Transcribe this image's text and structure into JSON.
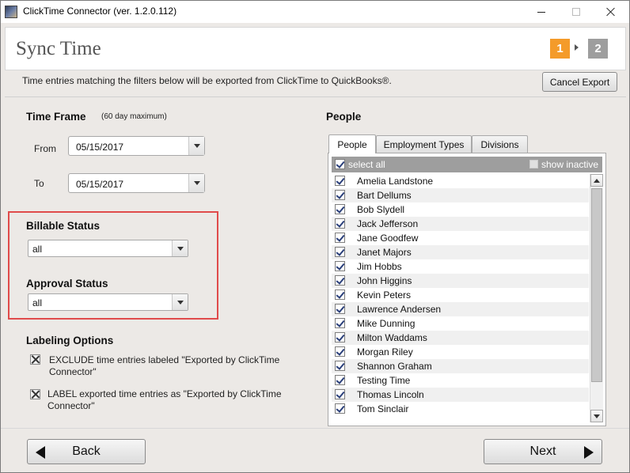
{
  "window": {
    "title": "ClickTime Connector (ver. 1.2.0.112)"
  },
  "header": {
    "page_title": "Sync Time",
    "steps": [
      "1",
      "2"
    ],
    "active_step": "1",
    "accent_color": "#f49b2a"
  },
  "description": "Time entries matching the filters below will be exported from ClickTime to QuickBooks®.",
  "cancel_label": "Cancel Export",
  "time_frame": {
    "title": "Time Frame",
    "note": "(60 day maximum)",
    "from_label": "From",
    "from_value": "05/15/2017",
    "to_label": "To",
    "to_value": "05/15/2017"
  },
  "billable": {
    "title": "Billable Status",
    "value": "all"
  },
  "approval": {
    "title": "Approval Status",
    "value": "all"
  },
  "labeling": {
    "title": "Labeling Options",
    "option1": "EXCLUDE time entries labeled \"Exported by ClickTime Connector\"",
    "option2": "LABEL exported time entries as \"Exported by ClickTime Connector\"",
    "option1_checked": true,
    "option2_checked": true
  },
  "people": {
    "title": "People",
    "tabs": [
      "People",
      "Employment Types",
      "Divisions"
    ],
    "active_tab": "People",
    "select_all_label": "select all",
    "show_inactive_label": "show inactive",
    "show_inactive_checked": false,
    "names": [
      "Amelia Landstone",
      "Bart Dellums",
      "Bob Slydell",
      "Jack Jefferson",
      "Jane Goodfew",
      "Janet Majors",
      "Jim Hobbs",
      "John Higgins",
      "Kevin Peters",
      "Lawrence Andersen",
      "Mike Dunning",
      "Milton Waddams",
      "Morgan Riley",
      "Shannon Graham",
      "Testing Time",
      "Thomas Lincoln",
      "Tom Sinclair"
    ]
  },
  "footer": {
    "back_label": "Back",
    "next_label": "Next"
  },
  "icons": {
    "app": "clicktime-app-icon",
    "minimize": "minimize-icon",
    "maximize": "maximize-icon",
    "close": "close-icon",
    "back": "arrow-left-icon",
    "next": "arrow-right-icon"
  }
}
